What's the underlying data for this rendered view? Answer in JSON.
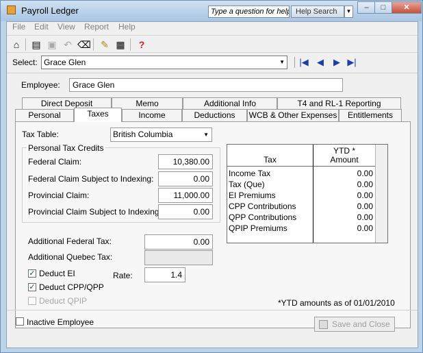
{
  "window": {
    "title": "Payroll Ledger",
    "ask_placeholder": "Type a question for help",
    "help_search": "Help Search"
  },
  "menu": [
    "File",
    "Edit",
    "View",
    "Report",
    "Help"
  ],
  "select": {
    "label": "Select:",
    "value": "Grace Glen"
  },
  "employee": {
    "label": "Employee:",
    "value": "Grace Glen"
  },
  "tabs_back": [
    "Direct Deposit",
    "Memo",
    "Additional Info",
    "T4 and RL-1 Reporting"
  ],
  "tabs_front": [
    "Personal",
    "Taxes",
    "Income",
    "Deductions",
    "WCB & Other Expenses",
    "Entitlements"
  ],
  "active_tab": "Taxes",
  "taxes": {
    "tax_table_label": "Tax Table:",
    "tax_table_value": "British Columbia",
    "credits_title": "Personal Tax Credits",
    "federal_claim_label": "Federal Claim:",
    "federal_claim": "10,380.00",
    "federal_indexing_label": "Federal Claim Subject to Indexing:",
    "federal_indexing": "0.00",
    "provincial_claim_label": "Provincial Claim:",
    "provincial_claim": "11,000.00",
    "provincial_indexing_label": "Provincial Claim Subject to Indexing:",
    "provincial_indexing": "0.00",
    "additional_federal_label": "Additional Federal Tax:",
    "additional_federal": "0.00",
    "additional_quebec_label": "Additional Quebec Tax:",
    "additional_quebec": "",
    "deduct_ei_label": "Deduct EI",
    "deduct_cpp_label": "Deduct CPP/QPP",
    "deduct_qpip_label": "Deduct QPIP",
    "rate_label": "Rate:",
    "rate": "1.4"
  },
  "ytd_table": {
    "col_tax": "Tax",
    "col_amount_1": "YTD *",
    "col_amount_2": "Amount",
    "rows": [
      {
        "name": "Income Tax",
        "amount": "0.00"
      },
      {
        "name": "Tax (Que)",
        "amount": "0.00"
      },
      {
        "name": "EI Premiums",
        "amount": "0.00"
      },
      {
        "name": "CPP Contributions",
        "amount": "0.00"
      },
      {
        "name": "QPP Contributions",
        "amount": "0.00"
      },
      {
        "name": "QPIP Premiums",
        "amount": "0.00"
      }
    ]
  },
  "footnote": "*YTD amounts as of 01/01/2010",
  "inactive_label": "Inactive Employee",
  "save_close": "Save and Close"
}
